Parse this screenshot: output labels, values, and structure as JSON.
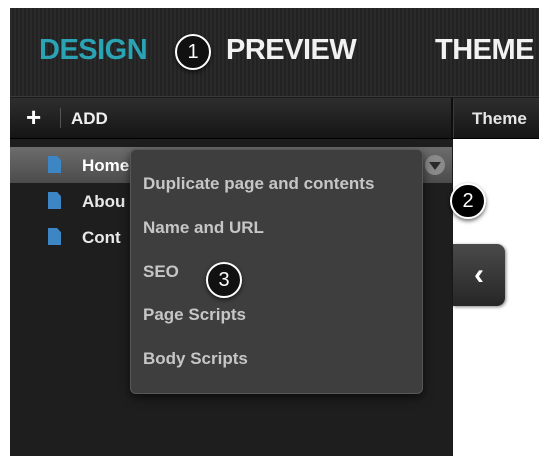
{
  "topnav": {
    "tabs": [
      {
        "label": "DESIGN"
      },
      {
        "label": "PREVIEW"
      },
      {
        "label": "THEME"
      }
    ]
  },
  "toolbar": {
    "add_icon": "plus-icon",
    "add_label": "ADD",
    "themes_label": "Theme"
  },
  "pages": [
    {
      "label": "Home",
      "icon": "page-icon",
      "selected": true
    },
    {
      "label": "Abou",
      "icon": "page-icon"
    },
    {
      "label": "Cont",
      "icon": "page-icon"
    }
  ],
  "context_menu": {
    "items": [
      "Duplicate page and contents",
      "Name and URL",
      "SEO",
      "Page Scripts",
      "Body Scripts"
    ]
  },
  "callouts": [
    "1",
    "2",
    "3"
  ],
  "collapse_tab": {
    "glyph": "‹",
    "icon": "chevron-left-icon"
  },
  "colors": {
    "accent": "#2aa3b5",
    "page_icon": "#3d86c6",
    "menu_bg": "#3e3e3e"
  }
}
